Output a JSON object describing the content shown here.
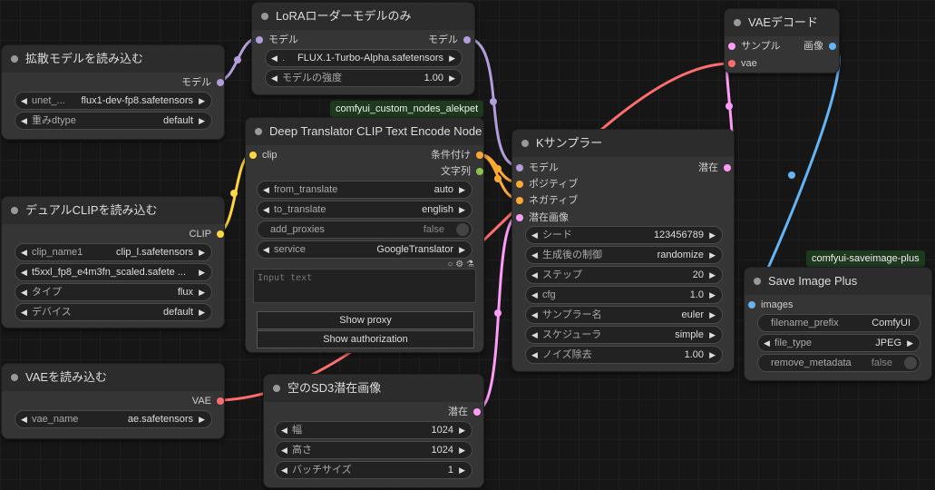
{
  "colors": {
    "model": "#b39ddb",
    "clip": "#ffd740",
    "conditioning": "#ffa931",
    "string": "#8bc34a",
    "latent": "#ff9cf9",
    "vae": "#ff6e6e",
    "image": "#64b5f6"
  },
  "nodes": {
    "loader": {
      "title": "拡散モデルを読み込む",
      "out_model": "モデル",
      "w_unet_label": "unet_...",
      "w_unet_value": "flux1-dev-fp8.safetensors",
      "w_dtype_label": "重みdtype",
      "w_dtype_value": "default"
    },
    "lora": {
      "title": "LoRAローダーモデルのみ",
      "in_model": "モデル",
      "out_model": "モデル",
      "w_lora_label": ".",
      "w_lora_value": "FLUX.1-Turbo-Alpha.safetensors",
      "w_strength_label": "モデルの強度",
      "w_strength_value": "1.00"
    },
    "translator": {
      "badge": "comfyui_custom_nodes_alekpet",
      "title": "Deep Translator CLIP Text Encode Node",
      "in_clip": "clip",
      "out_cond": "条件付け",
      "out_text": "文字列",
      "w_from_label": "from_translate",
      "w_from_value": "auto",
      "w_to_label": "to_translate",
      "w_to_value": "english",
      "w_proxies_label": "add_proxies",
      "w_proxies_value": "false",
      "w_service_label": "service",
      "w_service_value": "GoogleTranslator",
      "icons": "○ ⚙ ⚗",
      "textarea_placeholder": "Input text",
      "btn_proxy": "Show proxy",
      "btn_auth": "Show authorization"
    },
    "dualclip": {
      "title": "デュアルCLIPを読み込む",
      "out_clip": "CLIP",
      "w_name1_label": "clip_name1",
      "w_name1_value": "clip_l.safetensors",
      "w_name2_value": "t5xxl_fp8_e4m3fn_scaled.safete ...",
      "w_type_label": "タイプ",
      "w_type_value": "flux",
      "w_device_label": "デバイス",
      "w_device_value": "default"
    },
    "vaeloader": {
      "title": "VAEを読み込む",
      "out_vae": "VAE",
      "w_name_label": "vae_name",
      "w_name_value": "ae.safetensors"
    },
    "latent": {
      "title": "空のSD3潜在画像",
      "out_latent": "潜在",
      "w_width_label": "幅",
      "w_width_value": "1024",
      "w_height_label": "高さ",
      "w_height_value": "1024",
      "w_batch_label": "バッチサイズ",
      "w_batch_value": "1"
    },
    "ksampler": {
      "title": "Kサンプラー",
      "in_model": "モデル",
      "in_pos": "ポジティブ",
      "in_neg": "ネガティブ",
      "in_latent": "潜在画像",
      "out_latent": "潜在",
      "w_seed_label": "シード",
      "w_seed_value": "123456789",
      "w_ctrl_label": "生成後の制御",
      "w_ctrl_value": "randomize",
      "w_steps_label": "ステップ",
      "w_steps_value": "20",
      "w_cfg_label": "cfg",
      "w_cfg_value": "1.0",
      "w_sampler_label": "サンプラー名",
      "w_sampler_value": "euler",
      "w_sched_label": "スケジューラ",
      "w_sched_value": "simple",
      "w_denoise_label": "ノイズ除去",
      "w_denoise_value": "1.00"
    },
    "vaedecode": {
      "title": "VAEデコード",
      "in_samples": "サンプル",
      "in_vae": "vae",
      "out_image": "画像"
    },
    "saveplus": {
      "badge": "comfyui-saveimage-plus",
      "title": "Save Image Plus",
      "in_images": "images",
      "w_prefix_label": "filename_prefix",
      "w_prefix_value": "ComfyUI",
      "w_type_label": "file_type",
      "w_type_value": "JPEG",
      "w_meta_label": "remove_metadata",
      "w_meta_value": "false"
    }
  }
}
